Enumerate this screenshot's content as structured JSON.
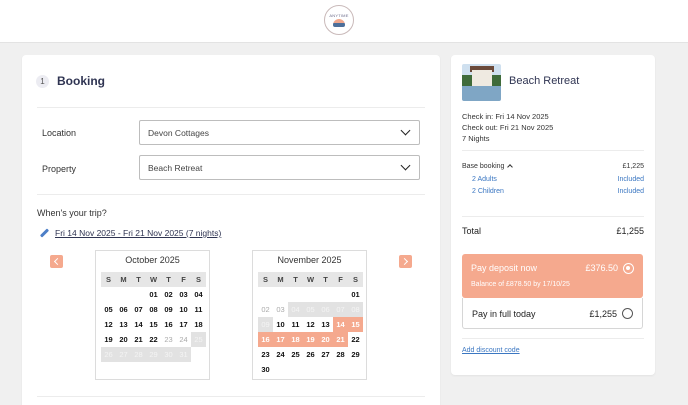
{
  "header": {
    "logo_text": "ANYTIME",
    "logo_icon": "sailboat-logo-icon"
  },
  "booking": {
    "step_number": "1",
    "title": "Booking",
    "location_label": "Location",
    "location_value": "Devon Cottages",
    "property_label": "Property",
    "property_value": "Beach Retreat",
    "trip_question": "When's your trip?",
    "date_range": "Fri 14 Nov 2025 - Fri 21 Nov 2025 (7 nights)",
    "weekdays": [
      "S",
      "M",
      "T",
      "W",
      "T",
      "F",
      "S"
    ],
    "calendars": [
      {
        "title": "October 2025",
        "cells": [
          {
            "d": "",
            "s": "empty"
          },
          {
            "d": "",
            "s": "empty"
          },
          {
            "d": "",
            "s": "empty"
          },
          {
            "d": "01",
            "s": "n"
          },
          {
            "d": "02",
            "s": "n"
          },
          {
            "d": "03",
            "s": "n"
          },
          {
            "d": "04",
            "s": "n"
          },
          {
            "d": "05",
            "s": "n"
          },
          {
            "d": "06",
            "s": "n"
          },
          {
            "d": "07",
            "s": "n"
          },
          {
            "d": "08",
            "s": "n"
          },
          {
            "d": "09",
            "s": "n"
          },
          {
            "d": "10",
            "s": "n"
          },
          {
            "d": "11",
            "s": "n"
          },
          {
            "d": "12",
            "s": "n"
          },
          {
            "d": "13",
            "s": "n"
          },
          {
            "d": "14",
            "s": "n"
          },
          {
            "d": "15",
            "s": "n"
          },
          {
            "d": "16",
            "s": "n"
          },
          {
            "d": "17",
            "s": "n"
          },
          {
            "d": "18",
            "s": "n"
          },
          {
            "d": "19",
            "s": "n"
          },
          {
            "d": "20",
            "s": "n"
          },
          {
            "d": "21",
            "s": "n"
          },
          {
            "d": "22",
            "s": "n"
          },
          {
            "d": "23",
            "s": "dis"
          },
          {
            "d": "24",
            "s": "dis"
          },
          {
            "d": "25",
            "s": "blk"
          },
          {
            "d": "26",
            "s": "blk"
          },
          {
            "d": "27",
            "s": "blk"
          },
          {
            "d": "28",
            "s": "blk"
          },
          {
            "d": "29",
            "s": "blk"
          },
          {
            "d": "30",
            "s": "blk"
          },
          {
            "d": "31",
            "s": "blk"
          },
          {
            "d": "",
            "s": "empty"
          }
        ]
      },
      {
        "title": "November 2025",
        "cells": [
          {
            "d": "",
            "s": "empty"
          },
          {
            "d": "",
            "s": "empty"
          },
          {
            "d": "",
            "s": "empty"
          },
          {
            "d": "",
            "s": "empty"
          },
          {
            "d": "",
            "s": "empty"
          },
          {
            "d": "",
            "s": "empty"
          },
          {
            "d": "01",
            "s": "n"
          },
          {
            "d": "02",
            "s": "dis"
          },
          {
            "d": "03",
            "s": "dis"
          },
          {
            "d": "04",
            "s": "blk"
          },
          {
            "d": "05",
            "s": "blk"
          },
          {
            "d": "06",
            "s": "blk"
          },
          {
            "d": "07",
            "s": "blk"
          },
          {
            "d": "08",
            "s": "blk"
          },
          {
            "d": "09",
            "s": "blk"
          },
          {
            "d": "10",
            "s": "n"
          },
          {
            "d": "11",
            "s": "n"
          },
          {
            "d": "12",
            "s": "n"
          },
          {
            "d": "13",
            "s": "n"
          },
          {
            "d": "14",
            "s": "sel"
          },
          {
            "d": "15",
            "s": "sel"
          },
          {
            "d": "16",
            "s": "sel"
          },
          {
            "d": "17",
            "s": "sel"
          },
          {
            "d": "18",
            "s": "sel"
          },
          {
            "d": "19",
            "s": "sel"
          },
          {
            "d": "20",
            "s": "sel"
          },
          {
            "d": "21",
            "s": "sel"
          },
          {
            "d": "22",
            "s": "n"
          },
          {
            "d": "23",
            "s": "n"
          },
          {
            "d": "24",
            "s": "n"
          },
          {
            "d": "25",
            "s": "n"
          },
          {
            "d": "26",
            "s": "n"
          },
          {
            "d": "27",
            "s": "n"
          },
          {
            "d": "28",
            "s": "n"
          },
          {
            "d": "29",
            "s": "n"
          },
          {
            "d": "30",
            "s": "n"
          },
          {
            "d": "",
            "s": "empty"
          },
          {
            "d": "",
            "s": "empty"
          },
          {
            "d": "",
            "s": "empty"
          },
          {
            "d": "",
            "s": "empty"
          },
          {
            "d": "",
            "s": "empty"
          },
          {
            "d": "",
            "s": "empty"
          }
        ]
      }
    ]
  },
  "summary": {
    "property_name": "Beach Retreat",
    "check_in": "Check in: Fri 14 Nov 2025",
    "check_out": "Check out: Fri 21 Nov 2025",
    "nights": "7 Nights",
    "base_label": "Base booking",
    "base_amount": "£1,225",
    "adults_label": "2 Adults",
    "adults_value": "Included",
    "children_label": "2 Children",
    "children_value": "Included",
    "total_label": "Total",
    "total_amount": "£1,255",
    "deposit_label": "Pay deposit now",
    "deposit_amount": "£376.50",
    "deposit_balance": "Balance of £878.50 by 17/10/25",
    "full_label": "Pay in full today",
    "full_amount": "£1,255",
    "discount_link": "Add discount code"
  },
  "colors": {
    "accent": "#f5a98e",
    "link": "#3b77c2",
    "title": "#2f3452"
  }
}
